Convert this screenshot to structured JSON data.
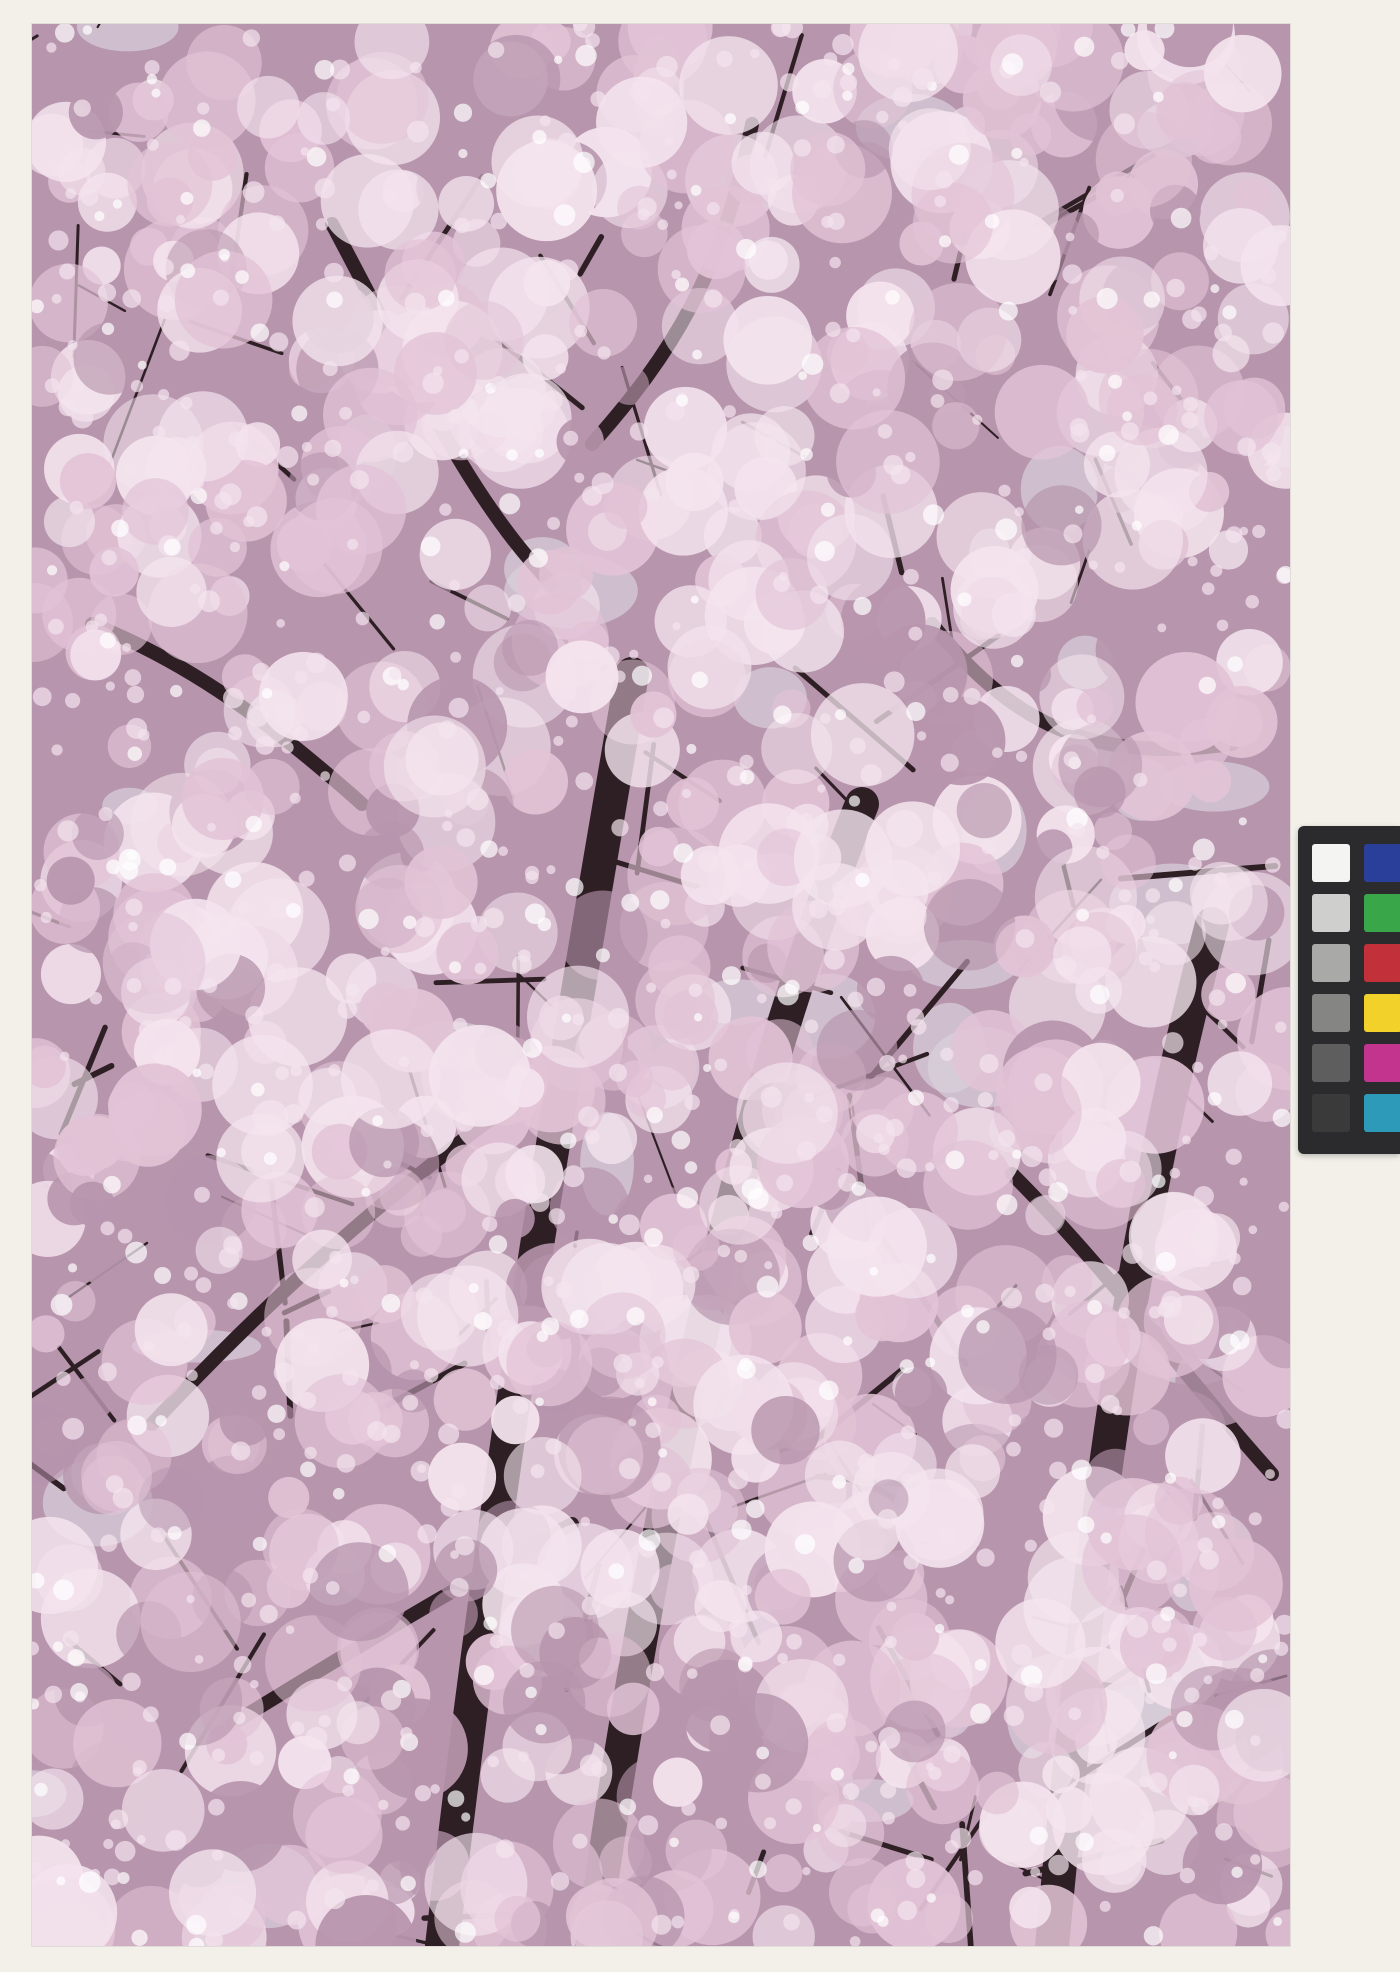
{
  "photo": {
    "subject": "cherry-blossom-tree",
    "palette": {
      "sky": "#d8d2dc",
      "blossom_light": "#f4e4ee",
      "blossom_mid": "#e2c3d6",
      "blossom_shadow": "#b795ad",
      "branch": "#2e1f24",
      "border": "#f2f0e9"
    }
  },
  "color_card": {
    "grays": [
      "#f4f4f2",
      "#cfcfcd",
      "#a9a9a7",
      "#858584",
      "#5e5e5e",
      "#3a3a3a"
    ],
    "colors": [
      "#2a3f9a",
      "#3aa64a",
      "#c2303a",
      "#f2d22a",
      "#c2348e",
      "#2c9ab8"
    ]
  }
}
